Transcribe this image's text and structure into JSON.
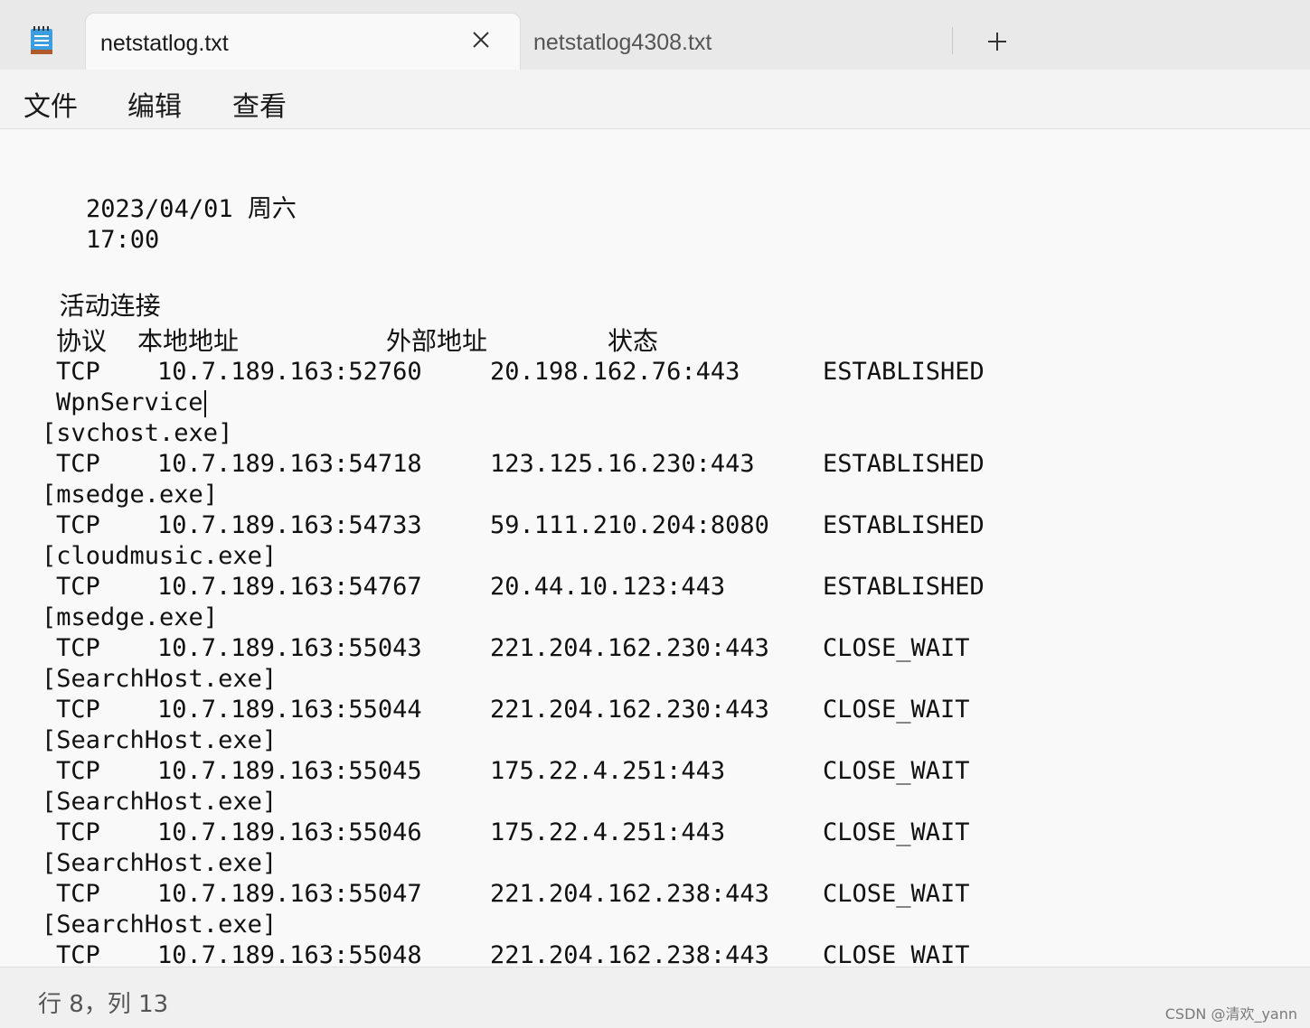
{
  "tabs": [
    {
      "label": "netstatlog.txt",
      "active": true
    },
    {
      "label": "netstatlog4308.txt",
      "active": false
    }
  ],
  "icons": {
    "app": "notepad-icon",
    "close": "close-icon",
    "new_tab": "plus-icon"
  },
  "menu": [
    "文件",
    "编辑",
    "查看"
  ],
  "content": {
    "date": "2023/04/01 周六",
    "time": "17:00",
    "heading": "活动连接",
    "columns": [
      "协议",
      "本地地址",
      "外部地址",
      "状态"
    ],
    "entries": [
      {
        "proto": "TCP",
        "local": "10.7.189.163:52760",
        "foreign": "20.198.162.76:443",
        "state": "ESTABLISHED",
        "service": "WpnService",
        "process": "[svchost.exe]"
      },
      {
        "proto": "TCP",
        "local": "10.7.189.163:54718",
        "foreign": "123.125.16.230:443",
        "state": "ESTABLISHED",
        "process": "[msedge.exe]"
      },
      {
        "proto": "TCP",
        "local": "10.7.189.163:54733",
        "foreign": "59.111.210.204:8080",
        "state": "ESTABLISHED",
        "process": "[cloudmusic.exe]"
      },
      {
        "proto": "TCP",
        "local": "10.7.189.163:54767",
        "foreign": "20.44.10.123:443",
        "state": "ESTABLISHED",
        "process": "[msedge.exe]"
      },
      {
        "proto": "TCP",
        "local": "10.7.189.163:55043",
        "foreign": "221.204.162.230:443",
        "state": "CLOSE_WAIT",
        "process": "[SearchHost.exe]"
      },
      {
        "proto": "TCP",
        "local": "10.7.189.163:55044",
        "foreign": "221.204.162.230:443",
        "state": "CLOSE_WAIT",
        "process": "[SearchHost.exe]"
      },
      {
        "proto": "TCP",
        "local": "10.7.189.163:55045",
        "foreign": "175.22.4.251:443",
        "state": "CLOSE_WAIT",
        "process": "[SearchHost.exe]"
      },
      {
        "proto": "TCP",
        "local": "10.7.189.163:55046",
        "foreign": "175.22.4.251:443",
        "state": "CLOSE_WAIT",
        "process": "[SearchHost.exe]"
      },
      {
        "proto": "TCP",
        "local": "10.7.189.163:55047",
        "foreign": "221.204.162.238:443",
        "state": "CLOSE_WAIT",
        "process": "[SearchHost.exe]"
      },
      {
        "proto": "TCP",
        "local": "10.7.189.163:55048",
        "foreign": "221.204.162.238:443",
        "state": "CLOSE_WAIT"
      }
    ]
  },
  "status": {
    "position": "行 8，列 13"
  },
  "watermark": "CSDN @清欢_yann"
}
